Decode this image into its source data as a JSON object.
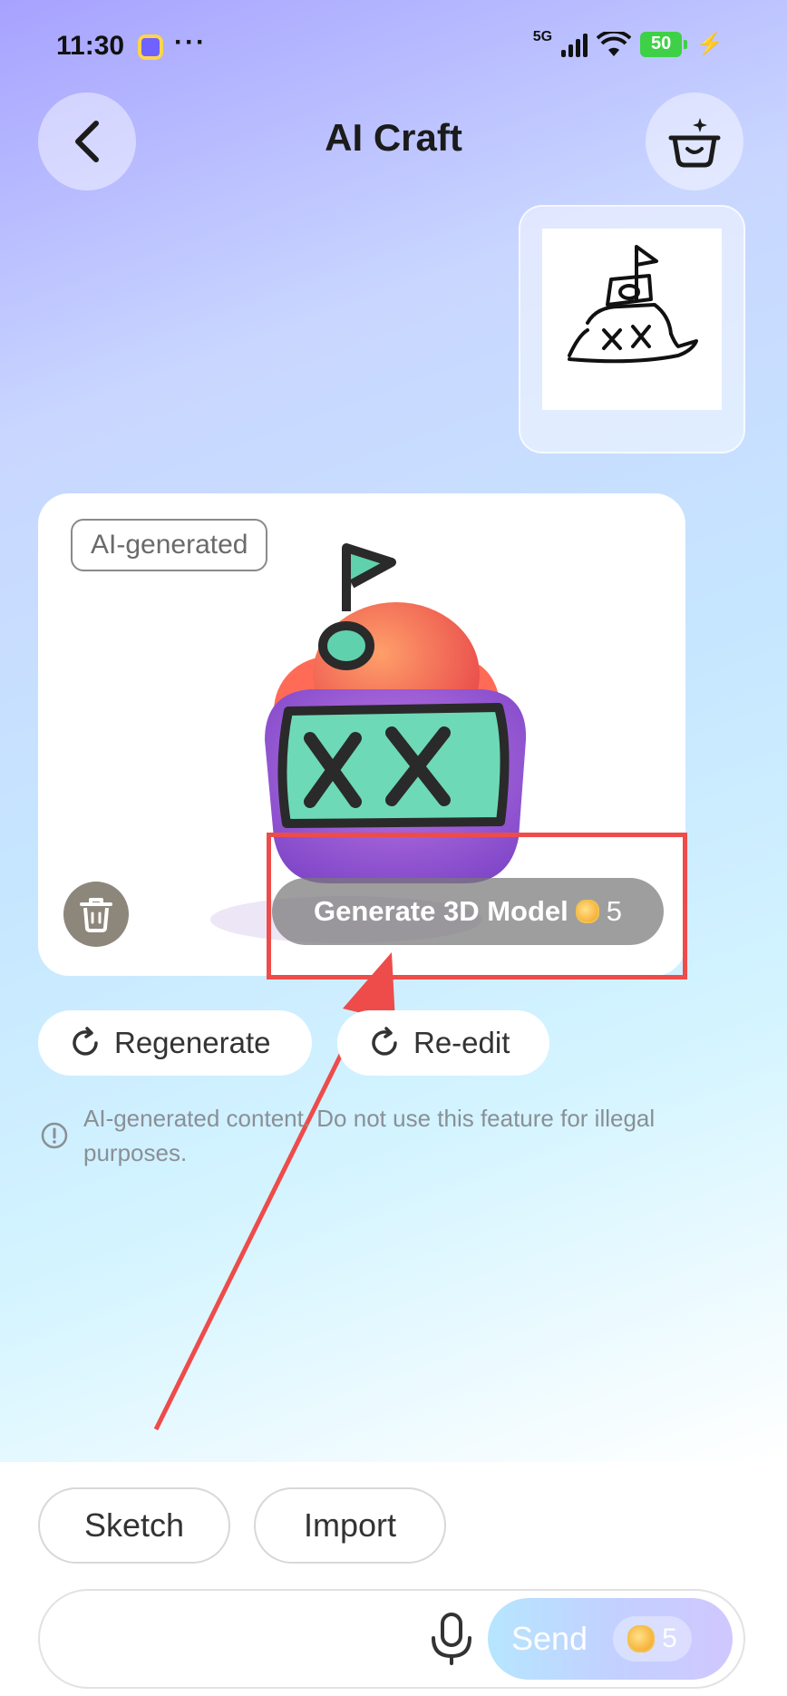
{
  "status_bar": {
    "time": "11:30",
    "more": "···",
    "network": "5G",
    "battery": "50"
  },
  "header": {
    "title": "AI Craft",
    "back_icon": "chevron-left-icon",
    "right_icon": "basket-sparkle-icon"
  },
  "result": {
    "badge": "AI-generated",
    "generate_label": "Generate 3D Model",
    "generate_cost": "5"
  },
  "actions": {
    "regenerate": "Regenerate",
    "reedit": "Re-edit"
  },
  "disclaimer": "AI-generated content. Do not use this feature for illegal purposes.",
  "bottom": {
    "tabs": [
      "Sketch",
      "Import"
    ],
    "send_label": "Send",
    "send_cost": "5"
  },
  "colors": {
    "highlight": "#ee4b4b",
    "battery": "#3ed147"
  }
}
